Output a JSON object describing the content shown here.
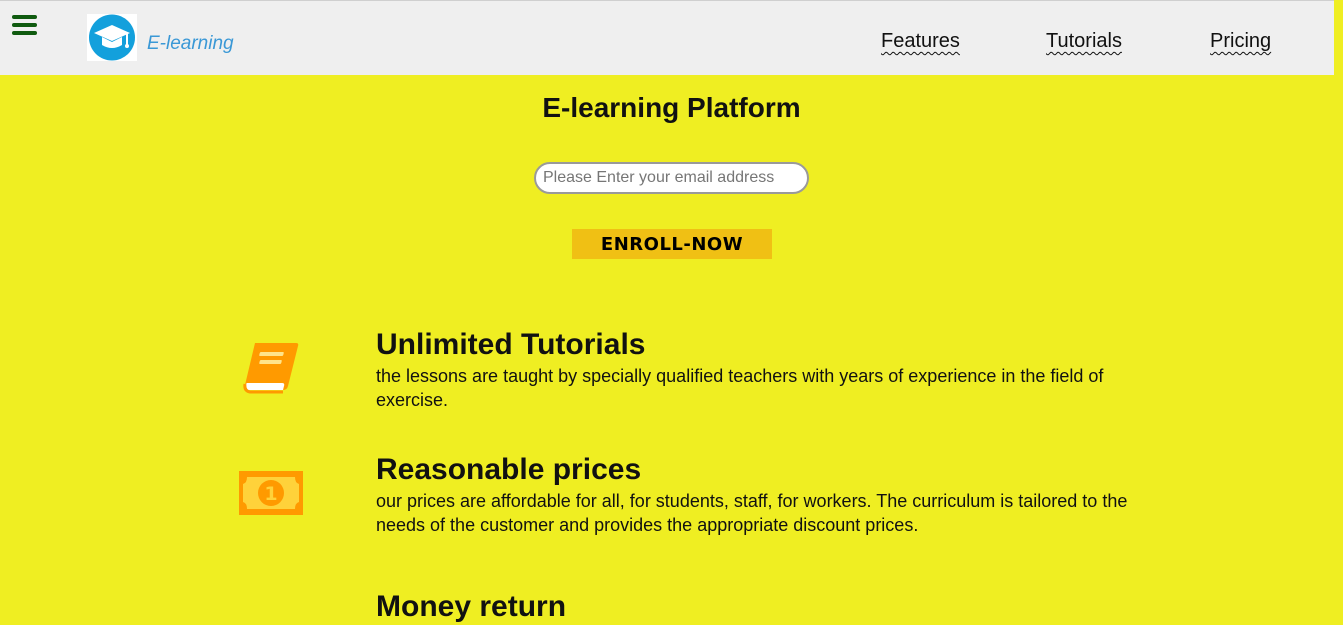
{
  "nav": {
    "brand": "E-learning",
    "links": [
      "Features",
      "Tutorials",
      "Pricing"
    ],
    "menu_icon": "hamburger-menu-icon",
    "logo_icon": "graduation-cap-icon"
  },
  "hero": {
    "title": "E-learning Platform",
    "email_placeholder": "Please Enter your email address",
    "email_value": "",
    "enroll_label": "ENROLL-NOW"
  },
  "features": [
    {
      "icon": "book-icon",
      "title": "Unlimited Tutorials",
      "text": "the lessons are taught by specially qualified teachers with years of experience in the field of exercise."
    },
    {
      "icon": "money-bill-icon",
      "title": "Reasonable prices",
      "text": "our prices are affordable for all, for students, staff, for workers. The curriculum is tailored to the needs of the customer and provides the appropriate discount prices."
    },
    {
      "icon": "",
      "title": "Money return",
      "text": ""
    }
  ],
  "colors": {
    "page_background": "#efee22",
    "navbar_background": "#efefef",
    "brand_text": "#3a98d6",
    "enroll_button": "#f0c014",
    "icon_orange": "#ff9a00",
    "menu_icon": "#0f5a0f"
  }
}
